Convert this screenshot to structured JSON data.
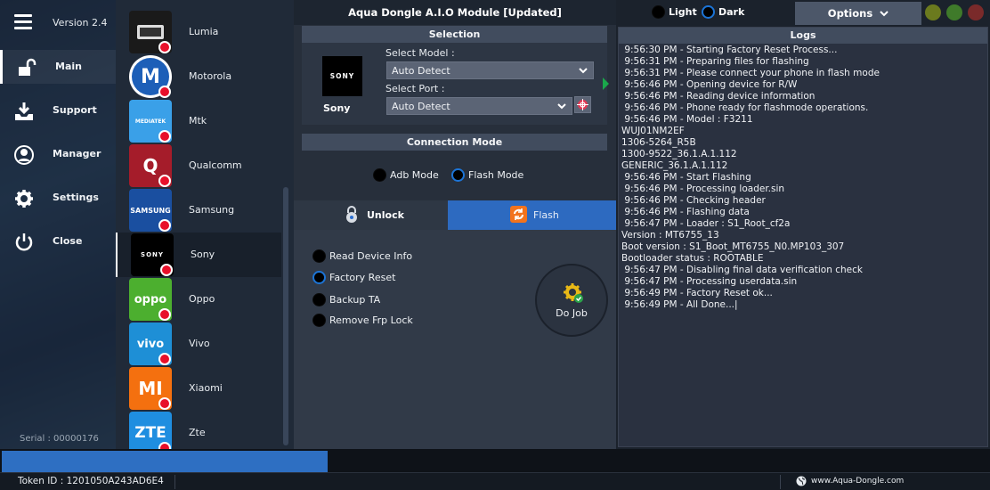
{
  "app": {
    "title": "Aqua Dongle A.I.O Module [Updated]",
    "version": "Version 2.4",
    "serial": "Serial : 00000176"
  },
  "nav": {
    "items": [
      {
        "label": "Main",
        "icon": "unlock-icon"
      },
      {
        "label": "Support",
        "icon": "download-icon"
      },
      {
        "label": "Manager",
        "icon": "user-icon"
      },
      {
        "label": "Settings",
        "icon": "gear-icon"
      },
      {
        "label": "Close",
        "icon": "power-icon"
      }
    ],
    "active": "Main"
  },
  "brands": [
    {
      "name": "Lumia",
      "logo": "",
      "color": "#2a2a2a"
    },
    {
      "name": "Motorola",
      "logo": "M",
      "color": "#1d5fb8"
    },
    {
      "name": "Mtk",
      "logo": "MEDIATEK",
      "color": "#3aa0e8"
    },
    {
      "name": "Qualcomm",
      "logo": "Q",
      "color": "#a51c2a"
    },
    {
      "name": "Samsung",
      "logo": "SAMSUNG",
      "color": "#1a4fa0"
    },
    {
      "name": "Sony",
      "logo": "SONY",
      "color": "#000000"
    },
    {
      "name": "Oppo",
      "logo": "oppo",
      "color": "#4caf2f"
    },
    {
      "name": "Vivo",
      "logo": "vivo",
      "color": "#1e8fd6"
    },
    {
      "name": "Xiaomi",
      "logo": "MI",
      "color": "#f4700f"
    },
    {
      "name": "Zte",
      "logo": "ZTE",
      "color": "#1f8ee0"
    }
  ],
  "selection": {
    "header": "Selection",
    "brand_logo": "SONY",
    "brand_name": "Sony",
    "model_label": "Select Model :",
    "model_value": "Auto Detect",
    "port_label": "Select Port :",
    "port_value": "Auto Detect"
  },
  "connection": {
    "header": "Connection Mode",
    "options": [
      "Adb Mode",
      "Flash Mode"
    ],
    "selected": "Flash Mode"
  },
  "tabs": [
    {
      "label": "Unlock",
      "icon": "lock-icon",
      "active": false
    },
    {
      "label": "Flash",
      "icon": "refresh-icon",
      "active": true
    }
  ],
  "operations": {
    "options": [
      "Read Device Info",
      "Factory Reset",
      "Backup TA",
      "Remove Frp Lock"
    ],
    "selected": "Factory Reset",
    "do_job_label": "Do Job"
  },
  "theme": {
    "options": [
      "Light",
      "Dark"
    ],
    "selected": "Dark",
    "options_label": "Options"
  },
  "window_buttons": [
    {
      "name": "minimize",
      "color": "#6b7a1e"
    },
    {
      "name": "maximize",
      "color": "#3f7a2a"
    },
    {
      "name": "close",
      "color": "#7a2a2a"
    }
  ],
  "logs": {
    "header": "Logs",
    "lines": [
      " 9:56:30 PM - Starting Factory Reset Process...",
      " 9:56:31 PM - Preparing files for flashing",
      " 9:56:31 PM - Please connect your phone in flash mode",
      " 9:56:46 PM - Opening device for R/W",
      " 9:56:46 PM - Reading device information",
      " 9:56:46 PM - Phone ready for flashmode operations.",
      " 9:56:46 PM - Model : F3211",
      "WUJ01NM2EF",
      "1306-5264_R5B",
      "1300-9522_36.1.A.1.112",
      "GENERIC_36.1.A.1.112",
      " 9:56:46 PM - Start Flashing",
      " 9:56:46 PM - Processing loader.sin",
      " 9:56:46 PM - Checking header",
      " 9:56:46 PM - Flashing data",
      " 9:56:47 PM - Loader : S1_Root_cf2a",
      "Version : MT6755_13",
      "Boot version : S1_Boot_MT6755_N0.MP103_307",
      "Bootloader status : ROOTABLE",
      " 9:56:47 PM - Disabling final data verification check",
      " 9:56:47 PM - Processing userdata.sin",
      " 9:56:49 PM - Factory Reset ok...",
      " 9:56:49 PM - All Done...|"
    ]
  },
  "progress": {
    "value": 0.33
  },
  "status": {
    "token": "Token ID : 1201050A243AD6E4",
    "website": "www.Aqua-Dongle.com"
  }
}
